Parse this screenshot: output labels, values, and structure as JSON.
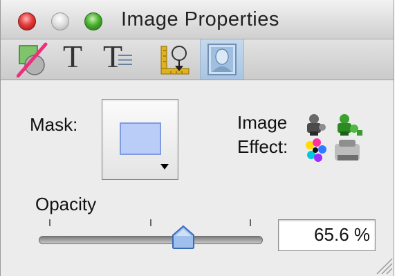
{
  "window": {
    "title": "Image Properties"
  },
  "toolbar": {
    "items": [
      {
        "name": "fill-stroke",
        "icon": "no-fill-icon"
      },
      {
        "name": "text",
        "icon": "text-T-icon",
        "glyph": "T"
      },
      {
        "name": "text-wrap",
        "icon": "text-wrap-icon",
        "glyph": "T"
      },
      {
        "name": "metrics",
        "icon": "metrics-ruler-icon"
      },
      {
        "name": "image",
        "icon": "image-portrait-icon",
        "selected": true
      }
    ]
  },
  "mask": {
    "label": "Mask:",
    "swatch_color": "#b9cdf8"
  },
  "image_effect": {
    "label_line1": "Image",
    "label_line2": "Effect:"
  },
  "opacity": {
    "label": "Opacity",
    "value_text": "65.6 %",
    "value": 0.656
  },
  "colors": {
    "selected_tool": "#a9c4e3",
    "close": "#e23b3b",
    "zoom": "#49b12e"
  }
}
